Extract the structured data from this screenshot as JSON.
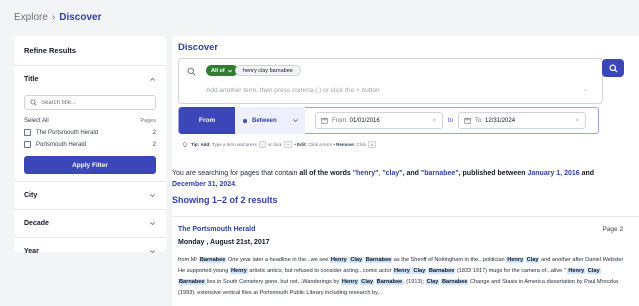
{
  "breadcrumb": {
    "root": "Explore",
    "separator": "›",
    "current": "Discover"
  },
  "sidebar": {
    "heading": "Refine Results",
    "title_facet": {
      "label": "Title",
      "search_placeholder": "Search title...",
      "select_all": "Select All",
      "pages_header": "Pages",
      "options": [
        {
          "label": "The Portsmouth Herald",
          "count": "2"
        },
        {
          "label": "Portsmouth Herald",
          "count": "2"
        }
      ],
      "apply_label": "Apply Filter"
    },
    "facets": [
      {
        "label": "City"
      },
      {
        "label": "Decade"
      },
      {
        "label": "Year"
      }
    ]
  },
  "main": {
    "title": "Discover",
    "query": {
      "operator": "All of",
      "term": "henry clay barnabee",
      "placeholder": "Add another term, then press comma (,) or click the + button",
      "plus": "+"
    },
    "date_filter": {
      "from_tag": "From",
      "mode": "Between",
      "from_label": "From:",
      "from_value": "01/01/2016",
      "to_sep": "to",
      "to_label": "To:",
      "to_value": "12/31/2024"
    },
    "tip": {
      "tip_label": "Tip:",
      "add_label": "Add:",
      "add_text": "Type a term and press",
      "key_comma": ",",
      "or_text": "or click",
      "key_plus": "+",
      "edit_label": "• Edit:",
      "edit_text": "Click a term",
      "remove_label": "• Remove:",
      "remove_text": "Click",
      "key_x": "x"
    },
    "summary": {
      "prefix": "You are searching for pages that contain",
      "all_words": "all of the words",
      "w1": "\"henry\"",
      "c1": ",",
      "w2": "\"clay\"",
      "c2": ", and",
      "w3": "\"barnabee\"",
      "mid": ", published between",
      "d1": "January 1, 2016",
      "and": "and",
      "d2": "December 31, 2024",
      "end": "."
    },
    "showing": "Showing 1–2 of 2 results",
    "result": {
      "publication": "The Portsmouth Herald",
      "page": "Page 2",
      "date": "Monday , August 21st, 2017"
    }
  }
}
